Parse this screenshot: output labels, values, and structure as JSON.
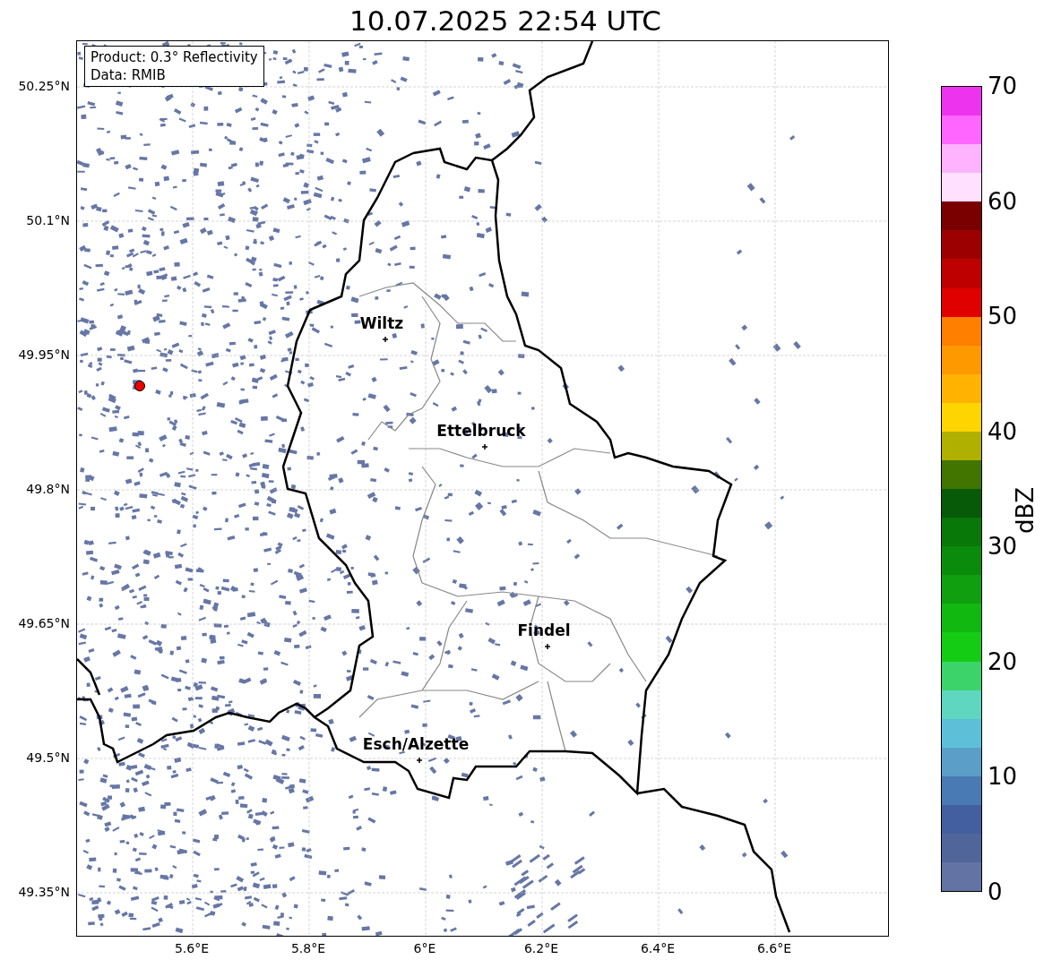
{
  "title": "10.07.2025 22:54 UTC",
  "legend": [
    "Product: 0.3° Reflectivity",
    "Data: RMIB"
  ],
  "map": {
    "cities": [
      {
        "name": "Wiltz"
      },
      {
        "name": "Ettelbruck"
      },
      {
        "name": "Findel"
      },
      {
        "name": "Esch/Alzette"
      }
    ],
    "lat_ticks": [
      "50.25°N",
      "50.1°N",
      "49.95°N",
      "49.8°N",
      "49.65°N",
      "49.5°N",
      "49.35°N"
    ],
    "lon_ticks": [
      "5.6°E",
      "5.8°E",
      "6°E",
      "6.2°E",
      "6.4°E",
      "6.6°E"
    ]
  },
  "colorbar": {
    "label": "dBZ",
    "ticks": [
      "70",
      "60",
      "50",
      "40",
      "30",
      "20",
      "10",
      "0"
    ],
    "segments": [
      {
        "color": "#6373a3"
      },
      {
        "color": "#50669b"
      },
      {
        "color": "#445f9f"
      },
      {
        "color": "#4a7ab3"
      },
      {
        "color": "#5b9fc8"
      },
      {
        "color": "#5ebfd9"
      },
      {
        "color": "#5ed6c0"
      },
      {
        "color": "#3cd46a"
      },
      {
        "color": "#14cc14"
      },
      {
        "color": "#10b810"
      },
      {
        "color": "#0f9f0f"
      },
      {
        "color": "#0b8b0b"
      },
      {
        "color": "#087808"
      },
      {
        "color": "#075a07"
      },
      {
        "color": "#427500"
      },
      {
        "color": "#b0b000"
      },
      {
        "color": "#ffd500"
      },
      {
        "color": "#ffb300"
      },
      {
        "color": "#ff9900"
      },
      {
        "color": "#ff7f00"
      },
      {
        "color": "#e00000"
      },
      {
        "color": "#bf0000"
      },
      {
        "color": "#9c0000"
      },
      {
        "color": "#7a0000"
      },
      {
        "color": "#ffe0ff"
      },
      {
        "color": "#ffb3ff"
      },
      {
        "color": "#ff66ff"
      },
      {
        "color": "#ee33ee"
      }
    ]
  }
}
